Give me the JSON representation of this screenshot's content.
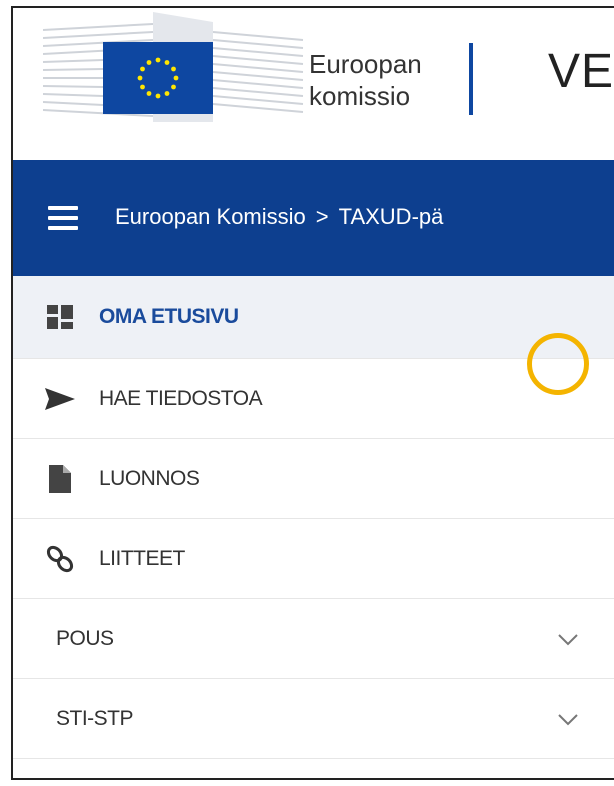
{
  "header": {
    "logo_line1": "Euroopan",
    "logo_line2": "komissio",
    "site_title": "VE"
  },
  "nav": {
    "breadcrumb": [
      "Euroopan Komissio",
      "TAXUD-pä"
    ],
    "breadcrumb_separator": ">"
  },
  "menu": {
    "items": [
      {
        "label": "OMA ETUSIVU",
        "icon": "dashboard-icon",
        "active": true
      },
      {
        "label": "HAE TIEDOSTOA",
        "icon": "send-icon"
      },
      {
        "label": "LUONNOS",
        "icon": "document-icon"
      },
      {
        "label": "LIITTEET",
        "icon": "link-icon"
      },
      {
        "label": "POUS",
        "icon": "chevron-down-icon",
        "highlighted": true
      },
      {
        "label": "STI-STP",
        "icon": "chevron-down-icon"
      }
    ]
  },
  "colors": {
    "brand_blue": "#0d3f8f",
    "eu_flag_blue": "#0e47a1",
    "eu_star_yellow": "#ffe600",
    "active_bg": "#eef1f6",
    "highlight": "#f4b400"
  }
}
